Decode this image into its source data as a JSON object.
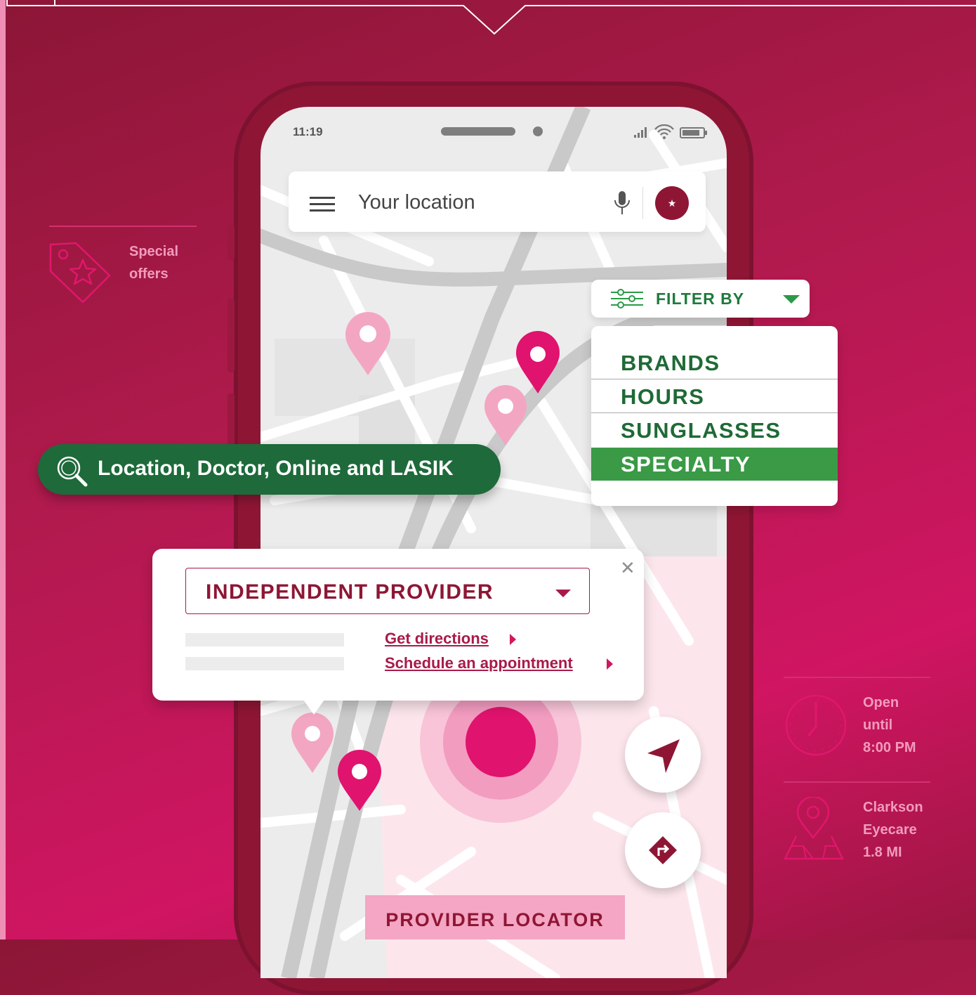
{
  "status_bar": {
    "time": "11:19"
  },
  "search": {
    "placeholder": "Your location"
  },
  "side_left": {
    "line1": "Special",
    "line2": "offers",
    "icon": "tag-star-icon"
  },
  "side_right_top": {
    "line1": "Open",
    "line2": "until",
    "line3": "8:00 PM",
    "icon": "clock-icon"
  },
  "side_right_bottom": {
    "line1": "Clarkson",
    "line2": "Eyecare",
    "line3": "1.8 MI",
    "icon": "map-pin-icon"
  },
  "filter": {
    "title": "FILTER BY",
    "options": [
      {
        "label": "BRANDS"
      },
      {
        "label": "HOURS"
      },
      {
        "label": "SUNGLASSES"
      },
      {
        "label": "SPECIALTY"
      }
    ],
    "selected": "SPECIALTY"
  },
  "location_pill": {
    "text": "Location, Doctor, Online and LASIK"
  },
  "provider_card": {
    "selected_type": "INDEPENDENT PROVIDER",
    "link_directions": "Get directions",
    "link_schedule": "Schedule an appointment"
  },
  "bottom_label": "PROVIDER LOCATOR",
  "colors": {
    "brand_maroon": "#8e1634",
    "accent_pink": "#e0136e",
    "filter_green": "#3a9a46",
    "pill_green": "#1e6a3a"
  }
}
